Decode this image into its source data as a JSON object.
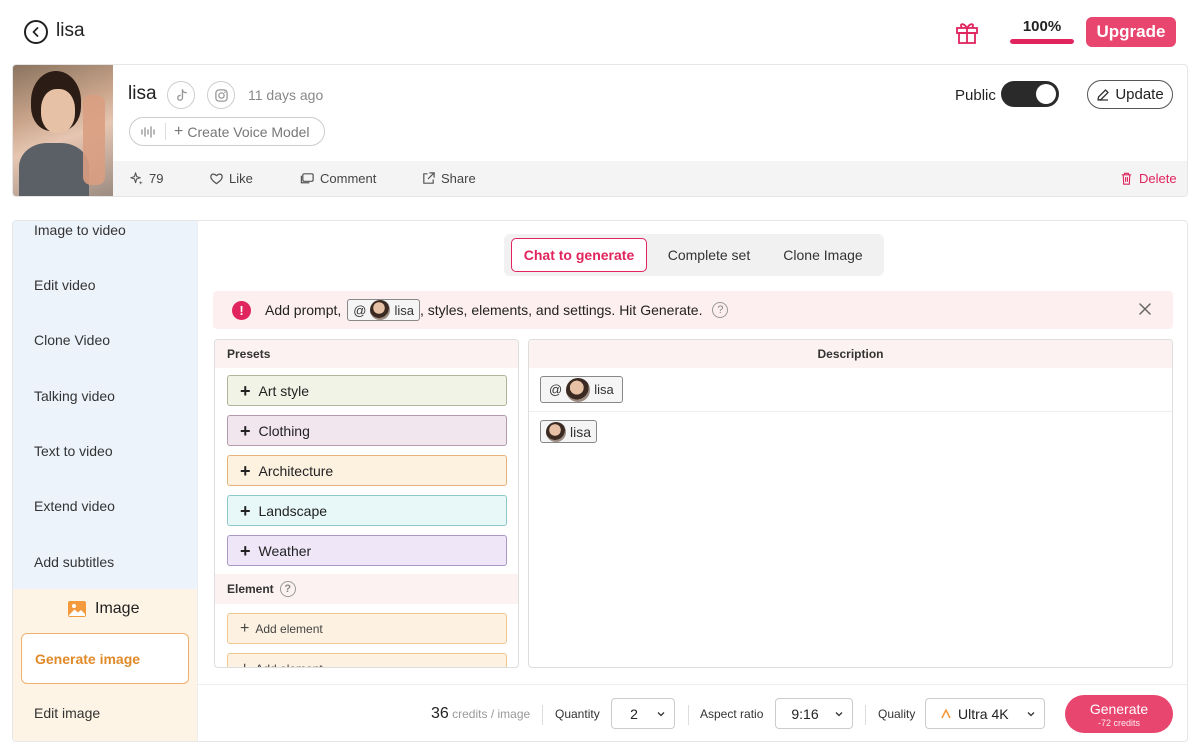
{
  "header": {
    "title": "lisa",
    "progress_text": "100%",
    "progress_fraction": 1.0,
    "upgrade_label": "Upgrade"
  },
  "profile": {
    "name": "lisa",
    "time_ago": "11 days ago",
    "voice_button_label": "Create Voice Model",
    "public_label": "Public",
    "public_on": true,
    "update_label": "Update",
    "actions": {
      "sparkle_count": "79",
      "like_label": "Like",
      "comment_label": "Comment",
      "share_label": "Share",
      "delete_label": "Delete"
    }
  },
  "sidebar": {
    "video_items": [
      "Image to video",
      "Edit video",
      "Clone Video",
      "Talking video",
      "Text to video",
      "Extend video",
      "Add subtitles"
    ],
    "image_heading": "Image",
    "image_items": [
      "Generate image",
      "Edit image"
    ]
  },
  "tabs": [
    "Chat to generate",
    "Complete set",
    "Clone Image"
  ],
  "info_bar": {
    "before": "Add prompt,",
    "chip_at": "@",
    "chip_name": "lisa",
    "after": ", styles, elements, and settings. Hit Generate.",
    "help": "?"
  },
  "presets": {
    "title": "Presets",
    "items": [
      {
        "label": "Art style",
        "bg": "#f1f3e6",
        "border": "#b0b49a"
      },
      {
        "label": "Clothing",
        "bg": "#f1e6ee",
        "border": "#b39aac"
      },
      {
        "label": "Architecture",
        "bg": "#fdf1e0",
        "border": "#e6b47a"
      },
      {
        "label": "Landscape",
        "bg": "#e8f7f7",
        "border": "#8fc7c7"
      },
      {
        "label": "Weather",
        "bg": "#efe6f8",
        "border": "#a998c4"
      }
    ],
    "element_title": "Element",
    "element_help": "?",
    "add_element_label": "Add element"
  },
  "description": {
    "title": "Description",
    "chip_at": "@",
    "chip_name": "lisa",
    "chip2_name": "lisa"
  },
  "bottom": {
    "credits_value": "36",
    "credits_unit": "credits / image",
    "quantity_label": "Quantity",
    "quantity_value": "2",
    "aspect_label": "Aspect ratio",
    "aspect_value": "9:16",
    "quality_label": "Quality",
    "quality_value": "Ultra 4K",
    "generate_label": "Generate",
    "generate_sub": "-72 credits"
  },
  "colors": {
    "accent": "#e0245e",
    "upgrade": "#e8456f",
    "sidebar_video_bg": "#edf3fb",
    "sidebar_image_bg": "#fdf4e6",
    "active_orange": "#e08a2a"
  }
}
